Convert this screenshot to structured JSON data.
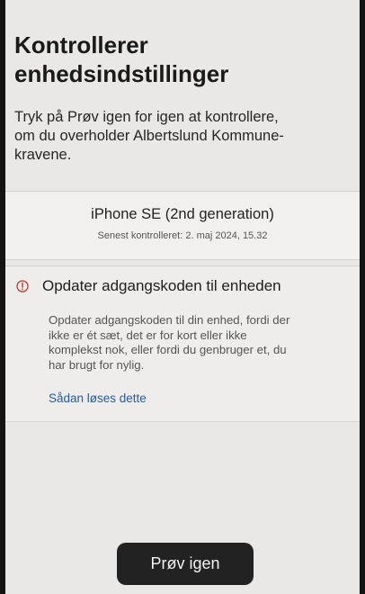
{
  "header": {
    "title": "Kontrollerer\nenhedsindstillinger",
    "subtitle": "Tryk på Prøv igen for igen at kontrollere,\nom du overholder Albertslund Kommune-\nkravene."
  },
  "device": {
    "name": "iPhone SE (2nd generation)",
    "last_checked": "Senest kontrolleret: 2. maj 2024, 15.32"
  },
  "issue": {
    "icon": "warning-circle-icon",
    "icon_color": "#c0392b",
    "title": "Opdater adgangskoden til enheden",
    "description": "Opdater adgangskoden til din enhed, fordi der\nikke er ét sæt, det er for kort eller ikke\nkomplekst nok, eller fordi du genbruger et, du\nhar brugt for nylig.",
    "link": "Sådan løses dette"
  },
  "actions": {
    "retry_label": "Prøv igen"
  },
  "colors": {
    "background": "#e9e8e6",
    "link": "#2d5a9a",
    "button": "#222222"
  }
}
